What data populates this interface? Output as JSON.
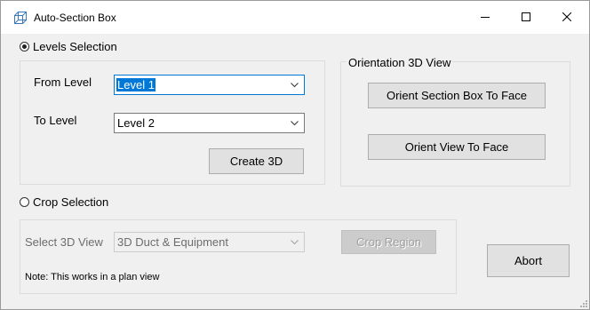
{
  "window": {
    "title": "Auto-Section Box",
    "icon": "cube-icon",
    "controls": {
      "minimize": "minimize-icon",
      "maximize": "maximize-icon",
      "close": "close-icon"
    }
  },
  "levels": {
    "radio_label": "Levels Selection",
    "selected": true,
    "from_label": "From Level",
    "from_value": "Level 1",
    "to_label": "To Level",
    "to_value": "Level 2",
    "create_button": "Create 3D"
  },
  "orientation": {
    "group_title": "Orientation 3D View",
    "orient_section_box": "Orient Section Box To Face",
    "orient_view": "Orient View To Face"
  },
  "crop": {
    "radio_label": "Crop Selection",
    "selected": false,
    "view_label": "Select 3D View",
    "view_value": "3D Duct & Equipment",
    "crop_button": "Crop Region",
    "note": "Note: This works in a plan view"
  },
  "abort_button": "Abort"
}
